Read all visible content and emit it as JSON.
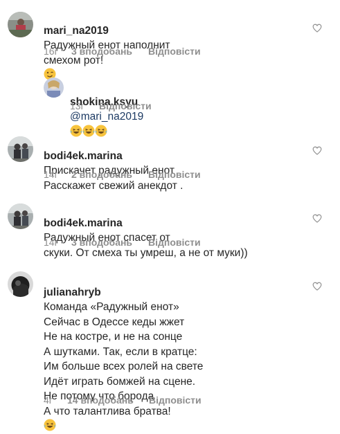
{
  "comments": [
    {
      "username": "mari_na2019",
      "text": "Радужный енот наполнит\nсмехом рот!",
      "emoji": "winking-face",
      "time": "16г",
      "likes": "3 вподобань",
      "reply": "Відповісти"
    },
    {
      "username": "shokina.ksyu",
      "mention": "@mari_na2019",
      "emoji": "laughing-face x3",
      "time": "13г",
      "reply": "Відповісти"
    },
    {
      "username": "bodi4ek.marina",
      "text": "Прискачет радужный енот\nРасскажет свежий анекдот .",
      "time": "14г",
      "likes": "2 вподобань",
      "reply": "Відповісти"
    },
    {
      "username": "bodi4ek.marina",
      "text": "Радужный енот спасет от\nскуки. От смеха ты умреш, а не от муки))",
      "time": "14г",
      "likes": "3 вподобань",
      "reply": "Відповісти"
    },
    {
      "username": "julianahryb",
      "text": "Команда «Радужный енот»\nСейчас в Одессе кеды жжет\nНе на костре, и не на сонце\nА шутками. Так, если в кратце:\nИм больше всех ролей на свете\nИдёт играть бомжей на сцене.\nНе потому что борода\nА что талантлива братва!",
      "emoji": "laughing-face",
      "time": "4г",
      "likes": "14 вподобань",
      "reply": "Відповісти"
    }
  ],
  "colors": {
    "text": "#262626",
    "meta": "#8e8e8e",
    "mention": "#1c3a63",
    "emoji": "#f7c33d"
  }
}
